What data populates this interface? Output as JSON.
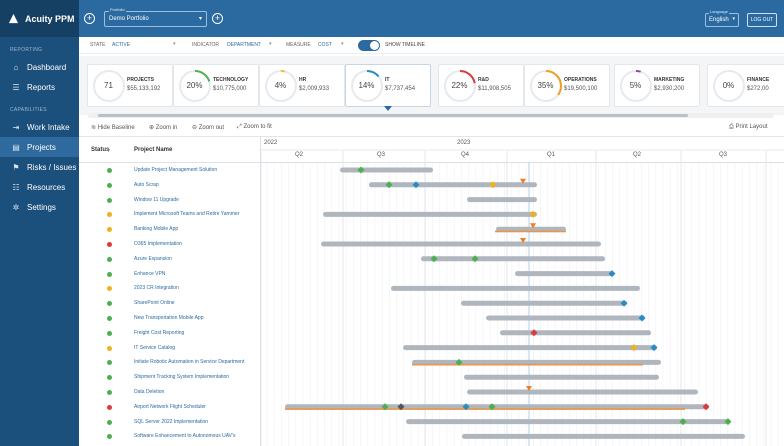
{
  "app": {
    "name": "Acuity PPM"
  },
  "sidebar": {
    "sections": [
      {
        "label": "REPORTING",
        "items": [
          {
            "key": "dashboard",
            "label": "Dashboard",
            "icon": "home-icon"
          },
          {
            "key": "reports",
            "label": "Reports",
            "icon": "reports-icon"
          }
        ]
      },
      {
        "label": "CAPABILITIES",
        "items": [
          {
            "key": "work-intake",
            "label": "Work Intake",
            "icon": "intake-icon"
          },
          {
            "key": "projects",
            "label": "Projects",
            "icon": "projects-icon",
            "active": true
          },
          {
            "key": "risks-issues",
            "label": "Risks / Issues",
            "icon": "risks-icon"
          },
          {
            "key": "resources",
            "label": "Resources",
            "icon": "resources-icon"
          },
          {
            "key": "settings",
            "label": "Settings",
            "icon": "gear-icon"
          }
        ]
      }
    ]
  },
  "topbar": {
    "portfolio_label": "Portfolio",
    "portfolio_value": "Demo Portfolio",
    "language_label": "Language",
    "language_value": "English",
    "logout_label": "LOG OUT"
  },
  "filters": {
    "state_label": "STATE",
    "state_value": "ACTIVE",
    "indicator_label": "INDICATOR",
    "indicator_value": "DEPARTMENT",
    "measure_label": "MEASURE",
    "measure_value": "COST",
    "show_timeline_label": "SHOW TIMELINE"
  },
  "kpis": [
    {
      "name": "PROJECTS",
      "pct_text": "71",
      "amount": "$55,133,192",
      "fill": 0,
      "color": "#9aa3ab"
    },
    {
      "name": "TECHNOLOGY",
      "pct_text": "20%",
      "amount": "$10,775,000",
      "fill": 0.2,
      "color": "#4caf50"
    },
    {
      "name": "HR",
      "pct_text": "4%",
      "amount": "$2,009,933",
      "fill": 0.04,
      "color": "#e8c428"
    },
    {
      "name": "IT",
      "pct_text": "14%",
      "amount": "$7,737,454",
      "fill": 0.14,
      "color": "#2b8cc4",
      "selected": true
    },
    {
      "name": "R&D",
      "pct_text": "22%",
      "amount": "$11,908,505",
      "fill": 0.22,
      "color": "#d93c3c"
    },
    {
      "name": "OPERATIONS",
      "pct_text": "35%",
      "amount": "$19,500,100",
      "fill": 0.35,
      "color": "#f0a020"
    },
    {
      "name": "MARKETING",
      "pct_text": "5%",
      "amount": "$2,930,200",
      "fill": 0.05,
      "color": "#8e44ad"
    },
    {
      "name": "FINANCE",
      "pct_text": "0%",
      "amount": "$272,00",
      "fill": 0,
      "color": "#9aa3ab"
    }
  ],
  "toolbar": {
    "hide_baseline": "Hide Baseline",
    "zoom_in": "Zoom in",
    "zoom_out": "Zoom out",
    "zoom_fit": "Zoom to fit",
    "print": "Print Layout"
  },
  "gantt": {
    "status_header": "Status",
    "name_header": "Project Name",
    "years": [
      {
        "label": "2022"
      },
      {
        "label": "2023"
      }
    ],
    "quarters": [
      "Q2",
      "Q3",
      "Q4",
      "Q1",
      "Q2",
      "Q3"
    ],
    "status_colors": {
      "green": "#4caf50",
      "yellow": "#f0b020",
      "red": "#d93c3c"
    },
    "rows": [
      {
        "name": "Update Project Management Solution",
        "status": "green"
      },
      {
        "name": "Auto Scrap",
        "status": "green"
      },
      {
        "name": "Window 11 Upgrade",
        "status": "green"
      },
      {
        "name": "Implement Microsoft Teams and Retire Yammer",
        "status": "yellow"
      },
      {
        "name": "Banking Mobile App",
        "status": "yellow"
      },
      {
        "name": "O365 Implementation",
        "status": "red"
      },
      {
        "name": "Azure Expansion",
        "status": "green"
      },
      {
        "name": "Enhance VPN",
        "status": "green"
      },
      {
        "name": "2023 CR Integration",
        "status": "yellow"
      },
      {
        "name": "SharePoint Online",
        "status": "green"
      },
      {
        "name": "New Transportation Mobile App",
        "status": "green"
      },
      {
        "name": "Freight Cost Reporting",
        "status": "green"
      },
      {
        "name": "IT Service Catalog",
        "status": "yellow"
      },
      {
        "name": "Initiate Robotic Automation in Service Department",
        "status": "green"
      },
      {
        "name": "Shipment Tracking System Implementation",
        "status": "green"
      },
      {
        "name": "Data Deletion",
        "status": "green"
      },
      {
        "name": "Airport Network Flight Scheduler",
        "status": "red"
      },
      {
        "name": "SQL Server 2022 Implementation",
        "status": "green"
      },
      {
        "name": "Software Enhancement to Autonomous UAV's",
        "status": "green"
      }
    ]
  }
}
